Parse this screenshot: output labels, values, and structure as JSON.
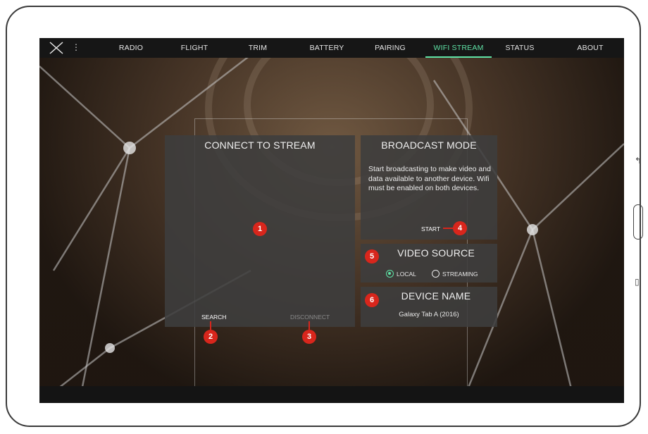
{
  "nav": {
    "tabs": [
      {
        "label": "RADIO"
      },
      {
        "label": "FLIGHT"
      },
      {
        "label": "TRIM"
      },
      {
        "label": "BATTERY"
      },
      {
        "label": "PAIRING"
      },
      {
        "label": "WIFI STREAM",
        "active": true
      },
      {
        "label": "STATUS"
      },
      {
        "label": "ABOUT"
      }
    ],
    "menu_icon": "vertical-dots-icon",
    "logo_icon": "x-logo-icon",
    "accent_color": "#5fe3a6"
  },
  "connect_panel": {
    "title": "CONNECT TO STREAM",
    "search_label": "SEARCH",
    "disconnect_label": "DISCONNECT"
  },
  "broadcast_panel": {
    "title": "BROADCAST MODE",
    "description": "Start broadcasting to make video and data available to another device. Wifi must be enabled on both devices.",
    "start_label": "START"
  },
  "video_source_panel": {
    "title": "VIDEO SOURCE",
    "options": [
      {
        "label": "LOCAL",
        "selected": true
      },
      {
        "label": "STREAMING",
        "selected": false
      }
    ]
  },
  "device_name_panel": {
    "title": "DEVICE NAME",
    "value": "Galaxy Tab A (2016)"
  },
  "callouts": [
    "1",
    "2",
    "3",
    "4",
    "5",
    "6"
  ],
  "callout_color": "#d8261c"
}
